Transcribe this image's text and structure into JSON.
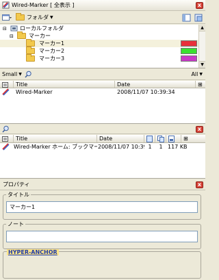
{
  "window": {
    "title": "Wired-Marker [ 全表示 ]"
  },
  "toolbar": {
    "folder_menu": "フォルダ"
  },
  "tree": {
    "root": "ローカルフォルダ",
    "parent": "マーカー",
    "items": [
      {
        "label": "マーカー1",
        "color": "#e8303a"
      },
      {
        "label": "マーカー2",
        "color": "#38e030"
      },
      {
        "label": "マーカー3",
        "color": "#c838c8"
      }
    ]
  },
  "list_toolbar": {
    "size": "Small",
    "filter": "All"
  },
  "list1": {
    "col_title": "Title",
    "col_date": "Date",
    "rows": [
      {
        "title": "Wired-Marker",
        "date": "2008/11/07 10:39:34"
      }
    ]
  },
  "list2": {
    "col_title": "Title",
    "col_date": "Date",
    "rows": [
      {
        "title": "Wired-Marker ホーム: ブックマーク, 特...",
        "date": "2008/11/07 10:39...",
        "c1": "1",
        "c2": "1",
        "size": "117 KB"
      }
    ]
  },
  "props": {
    "header": "プロパティ",
    "title_label": "タイトル",
    "title_value": "マーカー1",
    "note_label": "ノート",
    "note_value": "",
    "badge": "HYPER-ANCHOR"
  }
}
